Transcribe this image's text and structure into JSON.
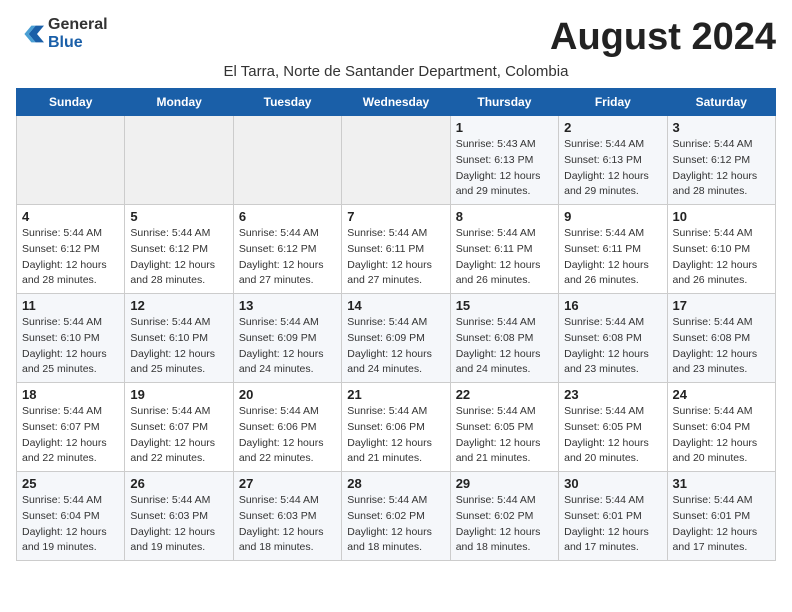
{
  "header": {
    "logo_line1": "General",
    "logo_line2": "Blue",
    "month_year": "August 2024",
    "location": "El Tarra, Norte de Santander Department, Colombia"
  },
  "weekdays": [
    "Sunday",
    "Monday",
    "Tuesday",
    "Wednesday",
    "Thursday",
    "Friday",
    "Saturday"
  ],
  "weeks": [
    [
      {
        "day": "",
        "info": ""
      },
      {
        "day": "",
        "info": ""
      },
      {
        "day": "",
        "info": ""
      },
      {
        "day": "",
        "info": ""
      },
      {
        "day": "1",
        "info": "Sunrise: 5:43 AM\nSunset: 6:13 PM\nDaylight: 12 hours\nand 29 minutes."
      },
      {
        "day": "2",
        "info": "Sunrise: 5:44 AM\nSunset: 6:13 PM\nDaylight: 12 hours\nand 29 minutes."
      },
      {
        "day": "3",
        "info": "Sunrise: 5:44 AM\nSunset: 6:12 PM\nDaylight: 12 hours\nand 28 minutes."
      }
    ],
    [
      {
        "day": "4",
        "info": "Sunrise: 5:44 AM\nSunset: 6:12 PM\nDaylight: 12 hours\nand 28 minutes."
      },
      {
        "day": "5",
        "info": "Sunrise: 5:44 AM\nSunset: 6:12 PM\nDaylight: 12 hours\nand 28 minutes."
      },
      {
        "day": "6",
        "info": "Sunrise: 5:44 AM\nSunset: 6:12 PM\nDaylight: 12 hours\nand 27 minutes."
      },
      {
        "day": "7",
        "info": "Sunrise: 5:44 AM\nSunset: 6:11 PM\nDaylight: 12 hours\nand 27 minutes."
      },
      {
        "day": "8",
        "info": "Sunrise: 5:44 AM\nSunset: 6:11 PM\nDaylight: 12 hours\nand 26 minutes."
      },
      {
        "day": "9",
        "info": "Sunrise: 5:44 AM\nSunset: 6:11 PM\nDaylight: 12 hours\nand 26 minutes."
      },
      {
        "day": "10",
        "info": "Sunrise: 5:44 AM\nSunset: 6:10 PM\nDaylight: 12 hours\nand 26 minutes."
      }
    ],
    [
      {
        "day": "11",
        "info": "Sunrise: 5:44 AM\nSunset: 6:10 PM\nDaylight: 12 hours\nand 25 minutes."
      },
      {
        "day": "12",
        "info": "Sunrise: 5:44 AM\nSunset: 6:10 PM\nDaylight: 12 hours\nand 25 minutes."
      },
      {
        "day": "13",
        "info": "Sunrise: 5:44 AM\nSunset: 6:09 PM\nDaylight: 12 hours\nand 24 minutes."
      },
      {
        "day": "14",
        "info": "Sunrise: 5:44 AM\nSunset: 6:09 PM\nDaylight: 12 hours\nand 24 minutes."
      },
      {
        "day": "15",
        "info": "Sunrise: 5:44 AM\nSunset: 6:08 PM\nDaylight: 12 hours\nand 24 minutes."
      },
      {
        "day": "16",
        "info": "Sunrise: 5:44 AM\nSunset: 6:08 PM\nDaylight: 12 hours\nand 23 minutes."
      },
      {
        "day": "17",
        "info": "Sunrise: 5:44 AM\nSunset: 6:08 PM\nDaylight: 12 hours\nand 23 minutes."
      }
    ],
    [
      {
        "day": "18",
        "info": "Sunrise: 5:44 AM\nSunset: 6:07 PM\nDaylight: 12 hours\nand 22 minutes."
      },
      {
        "day": "19",
        "info": "Sunrise: 5:44 AM\nSunset: 6:07 PM\nDaylight: 12 hours\nand 22 minutes."
      },
      {
        "day": "20",
        "info": "Sunrise: 5:44 AM\nSunset: 6:06 PM\nDaylight: 12 hours\nand 22 minutes."
      },
      {
        "day": "21",
        "info": "Sunrise: 5:44 AM\nSunset: 6:06 PM\nDaylight: 12 hours\nand 21 minutes."
      },
      {
        "day": "22",
        "info": "Sunrise: 5:44 AM\nSunset: 6:05 PM\nDaylight: 12 hours\nand 21 minutes."
      },
      {
        "day": "23",
        "info": "Sunrise: 5:44 AM\nSunset: 6:05 PM\nDaylight: 12 hours\nand 20 minutes."
      },
      {
        "day": "24",
        "info": "Sunrise: 5:44 AM\nSunset: 6:04 PM\nDaylight: 12 hours\nand 20 minutes."
      }
    ],
    [
      {
        "day": "25",
        "info": "Sunrise: 5:44 AM\nSunset: 6:04 PM\nDaylight: 12 hours\nand 19 minutes."
      },
      {
        "day": "26",
        "info": "Sunrise: 5:44 AM\nSunset: 6:03 PM\nDaylight: 12 hours\nand 19 minutes."
      },
      {
        "day": "27",
        "info": "Sunrise: 5:44 AM\nSunset: 6:03 PM\nDaylight: 12 hours\nand 18 minutes."
      },
      {
        "day": "28",
        "info": "Sunrise: 5:44 AM\nSunset: 6:02 PM\nDaylight: 12 hours\nand 18 minutes."
      },
      {
        "day": "29",
        "info": "Sunrise: 5:44 AM\nSunset: 6:02 PM\nDaylight: 12 hours\nand 18 minutes."
      },
      {
        "day": "30",
        "info": "Sunrise: 5:44 AM\nSunset: 6:01 PM\nDaylight: 12 hours\nand 17 minutes."
      },
      {
        "day": "31",
        "info": "Sunrise: 5:44 AM\nSunset: 6:01 PM\nDaylight: 12 hours\nand 17 minutes."
      }
    ]
  ]
}
